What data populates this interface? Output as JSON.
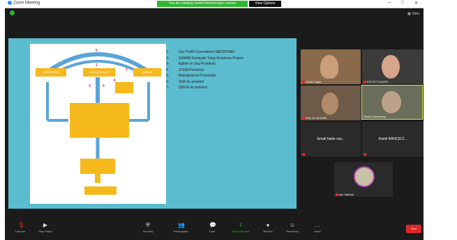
{
  "titlebar": {
    "app_name": "Zoom Meeting",
    "share_banner": "You are viewing Serkit Kökenmeşk's screen",
    "view_options": "View Options",
    "window_controls": [
      "—",
      "□",
      "✕"
    ]
  },
  "topbar": {
    "view_label": "View"
  },
  "slide": {
    "boxes": [
      "ÜNİVERSİTE",
      "BAKANLIKLAR",
      "SANAYİ",
      "",
      "",
      "",
      "",
      ""
    ],
    "markers": [
      "5",
      "1",
      "7",
      "3",
      "6",
      "4"
    ]
  },
  "list": {
    "items": [
      {
        "num": "1-",
        "text": "Üye Profili Güncelleme-MEDDENAV"
      },
      {
        "num": "2-",
        "text": "SANAB-Sanayide Yatay Araştırma Projesi"
      },
      {
        "num": "3-",
        "text": "Eğitim ve Staj Protokolü"
      },
      {
        "num": "4-",
        "text": "STEM Protokolü"
      },
      {
        "num": "5-",
        "text": "Belediyelerle Protokoller"
      },
      {
        "num": "6-",
        "text": "SGK ile protokol"
      },
      {
        "num": "7-",
        "text": "İŞKUR ile protokol"
      }
    ]
  },
  "participants": [
    {
      "name": "Orhan Yegin",
      "type": "video"
    },
    {
      "name": "ESTİKTİ KAÇRO",
      "type": "video"
    },
    {
      "name": "Prof. Dr. ALİCAN",
      "type": "video"
    },
    {
      "name": "Serkit Kökenmeşk",
      "type": "video"
    },
    {
      "name": "İsmail hakkı cav...",
      "type": "name"
    },
    {
      "name": "Kamil BAHÇECİ...",
      "type": "name"
    },
    {
      "name": "Işık Saltutal",
      "type": "avatar"
    }
  ],
  "toolbar": {
    "items": [
      {
        "label": "Unmute",
        "icon": "microphone-muted-icon",
        "glyph": "🎙"
      },
      {
        "label": "Stop Video",
        "icon": "video-camera-icon",
        "glyph": "▶"
      },
      {
        "label": "Security",
        "icon": "shield-icon",
        "glyph": "⛨"
      },
      {
        "label": "Participants",
        "icon": "participants-icon",
        "glyph": "👥"
      },
      {
        "label": "Chat",
        "icon": "chat-icon",
        "glyph": "💬"
      },
      {
        "label": "Share Screen",
        "icon": "share-screen-icon",
        "glyph": "⇧"
      },
      {
        "label": "Record",
        "icon": "record-icon",
        "glyph": "●"
      },
      {
        "label": "Reactions",
        "icon": "reactions-icon",
        "glyph": "☺"
      },
      {
        "label": "More",
        "icon": "more-icon",
        "glyph": "…"
      }
    ],
    "end_label": "End"
  },
  "colors": {
    "share_banner": "#2fb52f",
    "end_button": "#e02828",
    "shared_bg": "#5bbccf",
    "slide_box": "#f6b91b"
  }
}
